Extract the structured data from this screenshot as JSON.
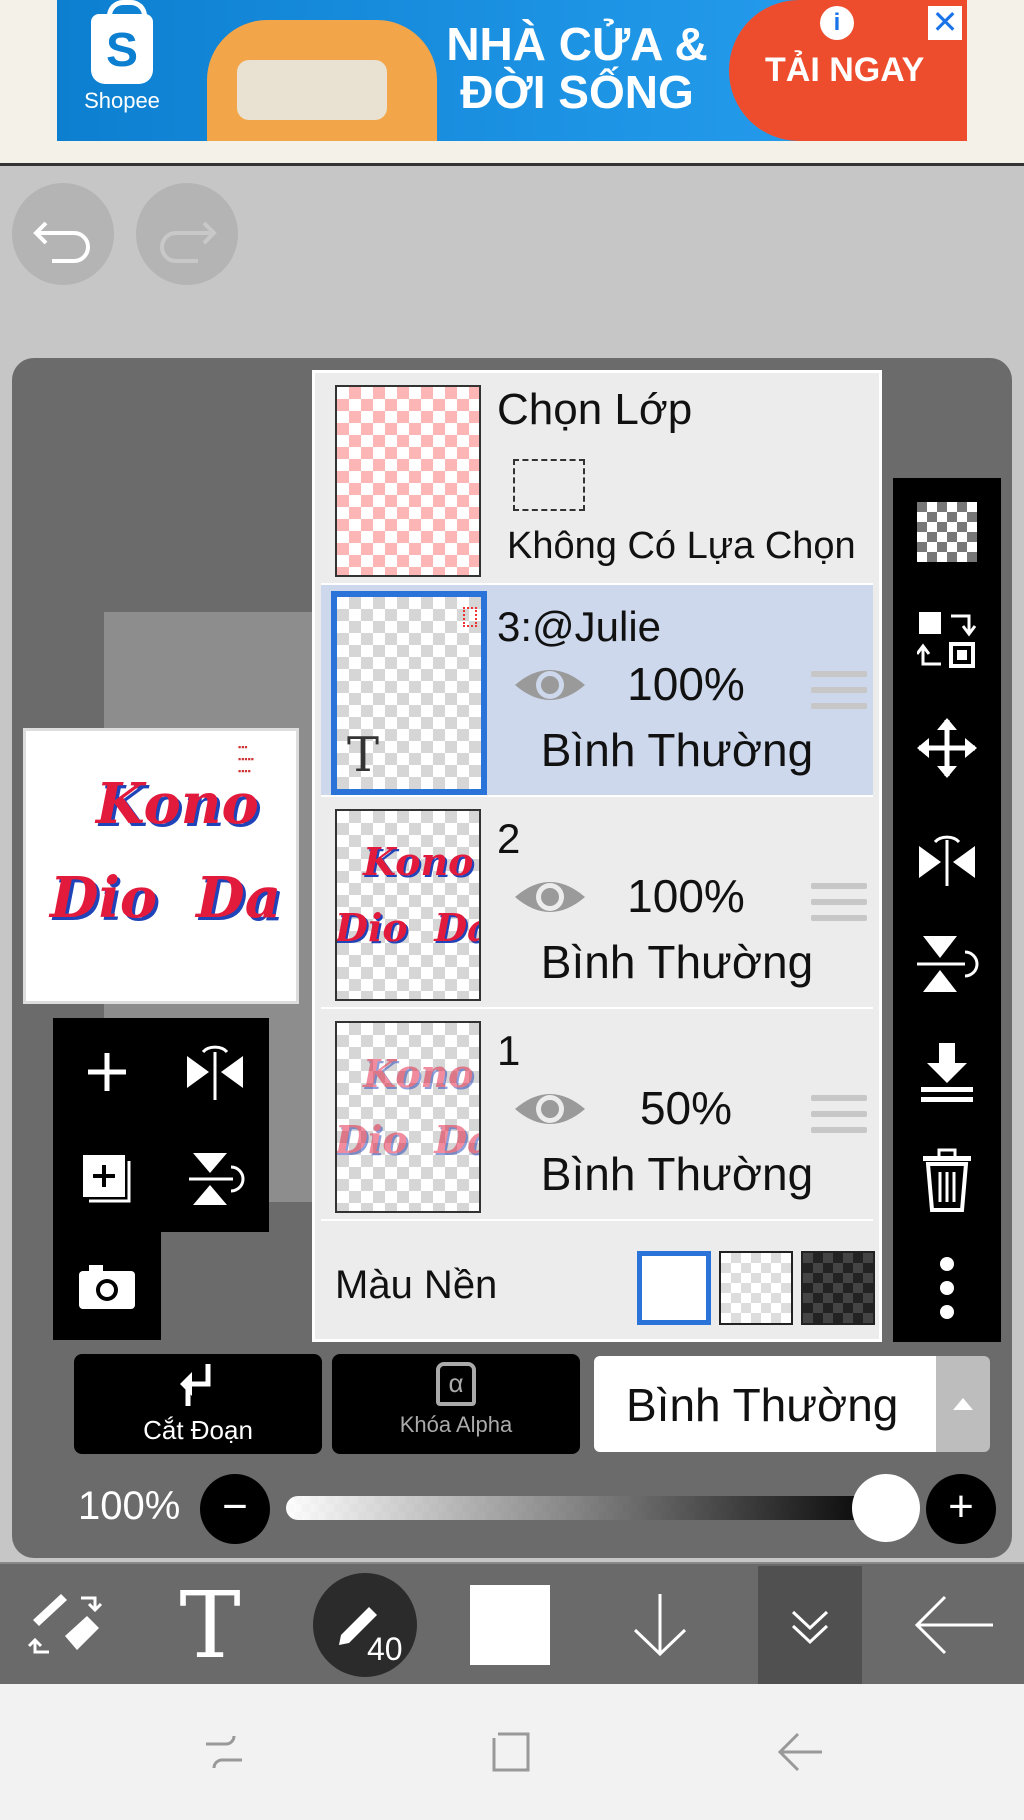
{
  "ad": {
    "brand": "Shopee",
    "brand_glyph": "S",
    "headline_line1": "NHÀ CỬA &",
    "headline_line2": "ĐỜI SỐNG",
    "cta": "TẢI NGAY",
    "info": "i",
    "close": "✕"
  },
  "canvas": {
    "preview_line1": "Kono",
    "preview_line2": "Dio  Da"
  },
  "layers_panel": {
    "selection": {
      "title": "Chọn Lớp",
      "subtitle": "Không Có Lựa Chọn"
    },
    "layers": [
      {
        "name": "3:@Julie",
        "opacity": "100%",
        "blend": "Bình Thường",
        "text_icon": "T",
        "selected": true
      },
      {
        "name": "2",
        "opacity": "100%",
        "blend": "Bình Thường",
        "thumb_line1": "Kono",
        "thumb_line2": "Dio  Da"
      },
      {
        "name": "1",
        "opacity": "50%",
        "blend": "Bình Thường",
        "thumb_line1": "Kono",
        "thumb_line2": "Dio  Da"
      }
    ],
    "background": {
      "label": "Màu Nền",
      "options": [
        "white",
        "transparent",
        "dark-checker"
      ],
      "selected": "white"
    }
  },
  "right_tools": [
    "checker-icon",
    "move-layer-icon",
    "move-icon",
    "flip-horizontal-icon",
    "flip-vertical-icon",
    "merge-down-icon",
    "trash-icon",
    "more-icon"
  ],
  "quick_tools": [
    "add-layer-icon",
    "flip-icon",
    "add-copy-icon",
    "rotate-icon",
    "camera-icon"
  ],
  "bottom_controls": {
    "clipping": "Cắt Đoạn",
    "alpha_lock": "Khóa Alpha",
    "alpha_glyph": "α",
    "blend_mode": "Bình Thường",
    "opacity_label": "100%",
    "opacity_value": 1.0,
    "minus": "−",
    "plus": "+"
  },
  "toolbar": {
    "text_tool": "T",
    "brush_size": "40"
  },
  "colors": {
    "accent": "#2a73d8",
    "selected_row": "#cdd8ec",
    "ad_blue": "#1e94e5",
    "ad_orange": "#ee4d2d"
  }
}
